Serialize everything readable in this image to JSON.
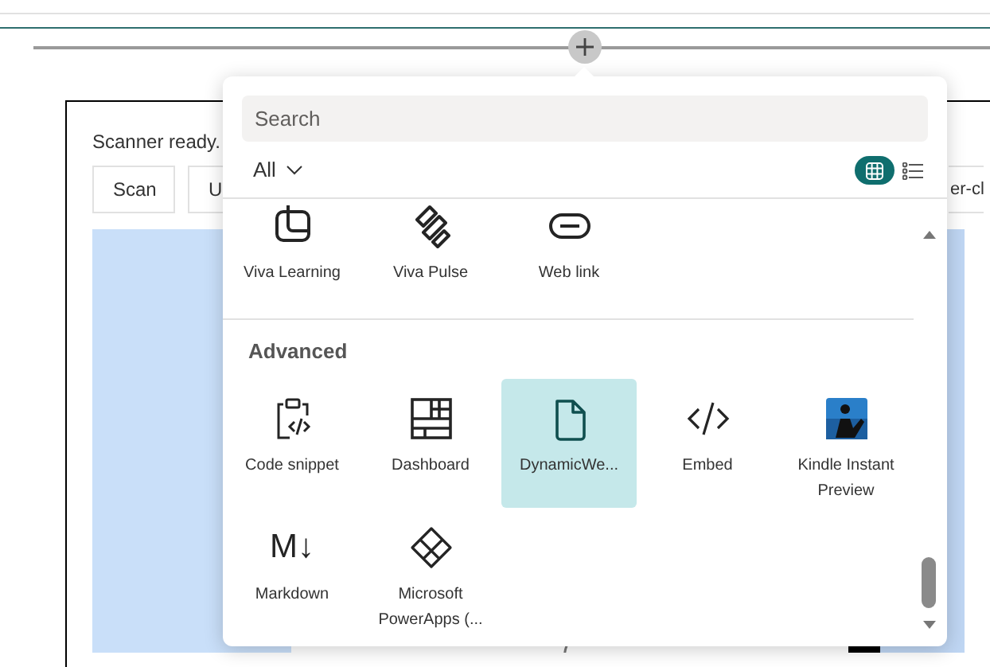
{
  "background": {
    "status": "Scanner ready.",
    "buttons": [
      {
        "label": "Scan"
      },
      {
        "label": "U"
      },
      {
        "label": "er-cl"
      }
    ]
  },
  "picker": {
    "search": {
      "placeholder": "Search"
    },
    "filter": {
      "label": "All"
    },
    "views": [
      {
        "selected": true
      },
      {
        "selected": false
      }
    ],
    "sections": [
      {
        "items": [
          {
            "label": "Viva Learning",
            "selected": false
          },
          {
            "label": "Viva Pulse",
            "selected": false
          },
          {
            "label": "Web link",
            "selected": false
          }
        ]
      },
      {
        "title": "Advanced",
        "items": [
          {
            "label": "Code snippet",
            "selected": false
          },
          {
            "label": "Dashboard",
            "selected": false
          },
          {
            "label": "DynamicWe...",
            "selected": true
          },
          {
            "label": "Embed",
            "selected": false
          },
          {
            "label": "Kindle Instant Preview",
            "selected": false
          },
          {
            "label": "Markdown",
            "selected": false,
            "glyph": "M↓"
          },
          {
            "label": "Microsoft PowerApps (...",
            "selected": false
          }
        ]
      }
    ]
  }
}
